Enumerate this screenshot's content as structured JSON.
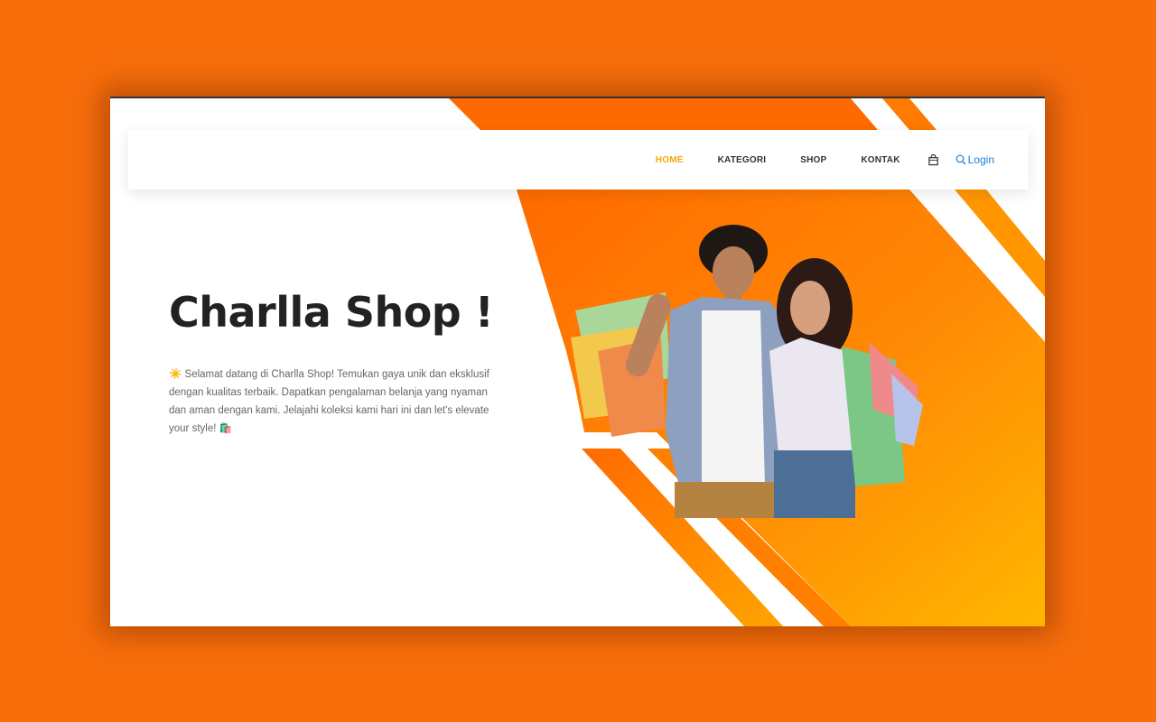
{
  "nav": {
    "items": [
      {
        "label": "HOME",
        "active": true
      },
      {
        "label": "KATEGORI",
        "active": false
      },
      {
        "label": "SHOP",
        "active": false
      },
      {
        "label": "KONTAK",
        "active": false
      }
    ],
    "cart_icon": "shopping-bag-icon",
    "login_icon": "search-icon",
    "login_label": "Login"
  },
  "hero": {
    "title": "Charlla Shop !",
    "sun_emoji": "☀️",
    "description": "Selamat datang di Charlla Shop! Temukan gaya unik dan eksklusif dengan kualitas terbaik. Dapatkan pengalaman belanja yang nyaman dan aman dengan kami. Jelajahi koleksi kami hari ini dan let's elevate your style!",
    "bag_emoji": "🛍️"
  },
  "colors": {
    "page_bg": "#f86e0b",
    "accent_orange": "#ff6a00",
    "accent_yellow": "#ffb300",
    "active_nav": "#f7a70b",
    "login_link": "#1a82d8",
    "title": "#222222"
  }
}
